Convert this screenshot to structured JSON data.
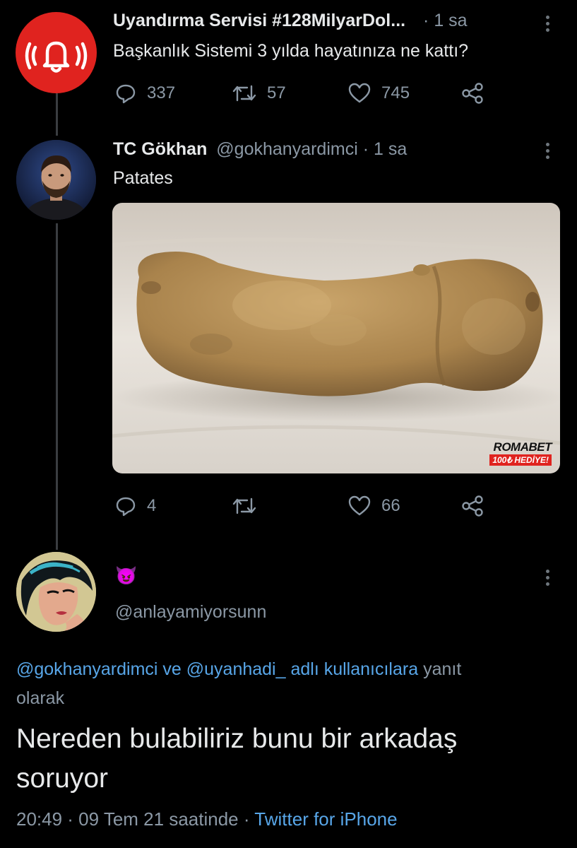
{
  "tweet1": {
    "display_name": "Uyandırma Servisi #128MilyarDol...",
    "time": "· 1 sa",
    "text": "Başkanlık Sistemi 3 yılda hayatınıza ne kattı?",
    "stats": {
      "replies": "337",
      "retweets": "57",
      "likes": "745"
    },
    "avatar_icon": "bell-alarm-icon",
    "avatar_color": "#e0231f"
  },
  "tweet2": {
    "display_name": "TC Gökhan",
    "handle": "@gokhanyardimci",
    "time": "· 1 sa",
    "text": "Patates",
    "stats": {
      "replies": "4",
      "retweets": "",
      "likes": "66"
    },
    "image_watermark": {
      "brand": "ROMABET",
      "tag": "100₺ HEDİYE!"
    }
  },
  "tweet3": {
    "display_name_emoji": "😈",
    "handle": "@anlayamiyorsunn",
    "reply_to": {
      "users": "@gokhanyardimci ve @uyanhadi_ adlı kullanıcılara",
      "suffix_line1": "yanıt",
      "suffix_line2": "olarak"
    },
    "text_line1": "Nereden bulabiliriz bunu bir arkadaş",
    "text_line2": "soruyor",
    "timestamp": "20:49 · 09 Tem 21 saatinde ·",
    "source": "Twitter for iPhone"
  },
  "colors": {
    "background": "#000000",
    "link": "#58a6e8",
    "muted": "#8b98a5"
  }
}
